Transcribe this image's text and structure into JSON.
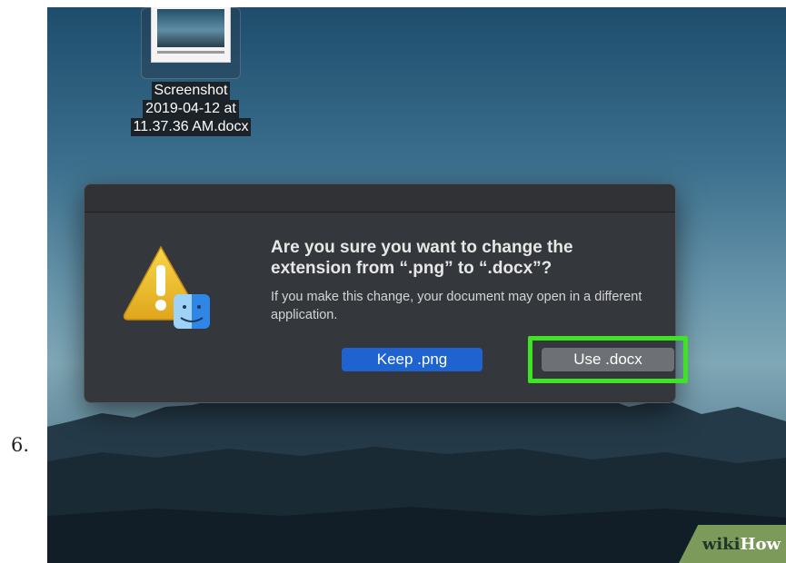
{
  "step_number": "6.",
  "desktop": {
    "file_label_lines": [
      "Screenshot",
      "2019-04-12 at",
      "11.37.36 AM.docx"
    ]
  },
  "dialog": {
    "title": "Are you sure you want to change the extension from “.png” to “.docx”?",
    "message": "If you make this change, your document may open in a different application.",
    "buttons": {
      "keep_label": "Keep .png",
      "use_label": "Use .docx"
    },
    "icon": "warning-finder-icon"
  },
  "watermark": {
    "wiki": "wiki",
    "how": "How"
  },
  "colors": {
    "highlight": "#3ee424",
    "primary_button": "#1e63d0",
    "secondary_button": "#6d7074"
  }
}
